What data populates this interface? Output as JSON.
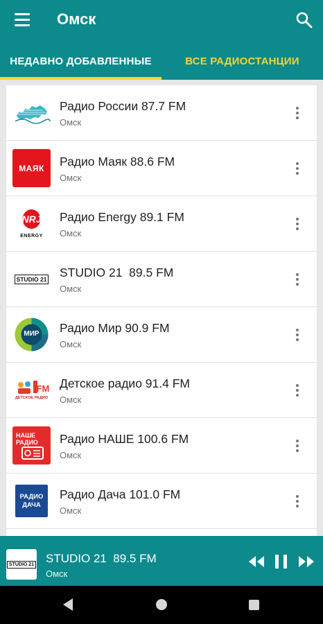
{
  "header": {
    "title": "Омск",
    "menu_icon": "menu-icon",
    "search_icon": "search-icon",
    "color": "#0c8a8c"
  },
  "tabs": [
    {
      "label": "НЕДАВНО ДОБАВЛЕННЫЕ",
      "selected": true
    },
    {
      "label": "ВСЕ РАДИОСТАНЦИИ",
      "selected": false
    }
  ],
  "accent": "#f6d331",
  "stations": [
    {
      "name": "Радио России 87.7 FM",
      "city": "Омск",
      "logo": "radio-rossii-logo"
    },
    {
      "name": "Радио Маяк 88.6 FM",
      "city": "Омск",
      "logo": "mayak-logo",
      "logo_text": "МАЯК"
    },
    {
      "name": "Радио Energy 89.1 FM",
      "city": "Омск",
      "logo": "energy-logo",
      "logo_text": "ENERGY"
    },
    {
      "name": "STUDIO 21  89.5 FM",
      "city": "Омск",
      "logo": "studio21-logo",
      "logo_text": "STUDIO 21"
    },
    {
      "name": "Радио Мир 90.9 FM",
      "city": "Омск",
      "logo": "mir-logo",
      "logo_text": "МИР"
    },
    {
      "name": "Детское радио 91.4 FM",
      "city": "Омск",
      "logo": "detskoe-radio-logo",
      "logo_text": "ДЕТСКОЕ РАДИО"
    },
    {
      "name": "Радио НАШЕ 100.6 FM",
      "city": "Омск",
      "logo": "nashe-logo",
      "logo_text": "НАШЕ РАДИО"
    },
    {
      "name": "Радио Дача 101.0 FM",
      "city": "Омск",
      "logo": "dacha-logo",
      "logo_text": "РАДИО ДАЧА"
    }
  ],
  "player": {
    "name": "STUDIO 21  89.5 FM",
    "city": "Омск",
    "logo": "studio21-logo",
    "logo_text": "STUDIO 21",
    "controls": [
      "rewind-icon",
      "pause-icon",
      "fast-forward-icon"
    ]
  },
  "navbar": [
    "back-icon",
    "home-icon",
    "recents-icon"
  ]
}
